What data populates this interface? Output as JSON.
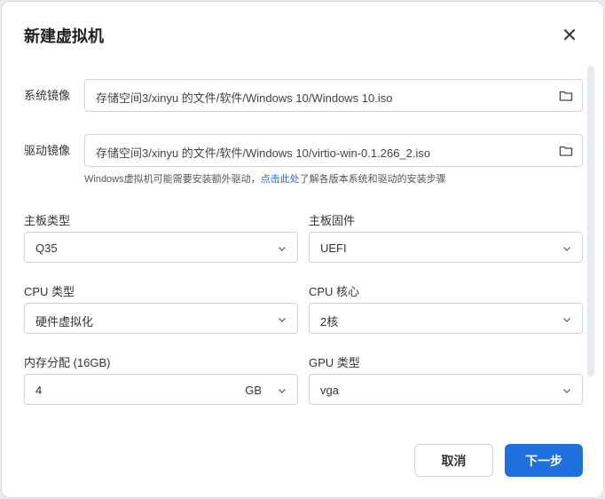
{
  "dialog": {
    "title": "新建虚拟机",
    "system_image": {
      "label": "系统镜像",
      "path": "存储空间3/xinyu 的文件/软件/Windows 10/Windows 10.iso"
    },
    "driver_image": {
      "label": "驱动镜像",
      "path": "存储空间3/xinyu 的文件/软件/Windows 10/virtio-win-0.1.266_2.iso"
    },
    "hint": {
      "before": "Windows虚拟机可能需要安装额外驱动，",
      "link": "点击此处",
      "after": "了解各版本系统和驱动的安装步骤"
    },
    "fields": {
      "motherboard_type": {
        "label": "主板类型",
        "value": "Q35"
      },
      "firmware": {
        "label": "主板固件",
        "value": "UEFI"
      },
      "cpu_type": {
        "label": "CPU 类型",
        "value": "硬件虚拟化"
      },
      "cpu_cores": {
        "label": "CPU 核心",
        "value": "2核"
      },
      "memory": {
        "label": "内存分配 (16GB)",
        "value": "4",
        "unit": "GB"
      },
      "gpu_type": {
        "label": "GPU 类型",
        "value": "vga"
      }
    },
    "buttons": {
      "cancel": "取消",
      "next": "下一步"
    }
  },
  "colors": {
    "accent": "#1f6fde",
    "link": "#2070d8"
  }
}
